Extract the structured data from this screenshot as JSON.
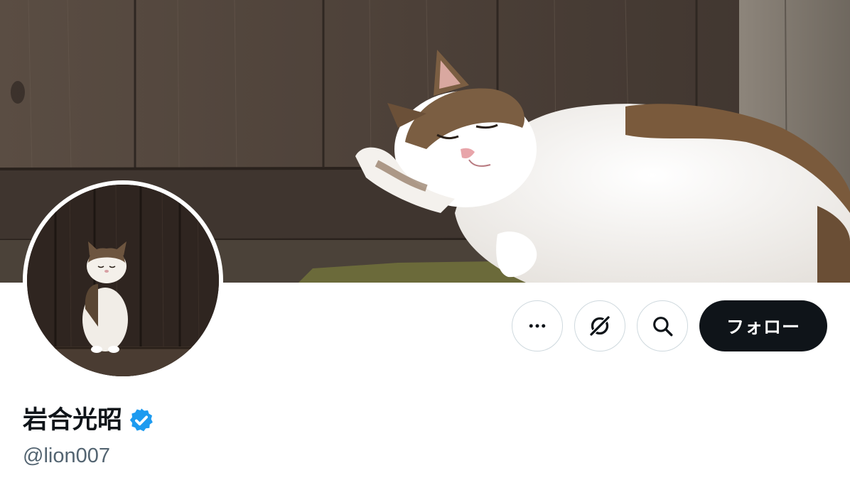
{
  "profile": {
    "display_name": "岩合光昭",
    "handle": "@lion007",
    "verified": true,
    "verified_color": "#1d9bf0"
  },
  "banner": {
    "image": "photo of a white-and-brown tabby cat stretching against a weathered wooden wall"
  },
  "avatar": {
    "image": "photo of a small cat sitting in front of dark wooden planks"
  },
  "actions": {
    "more_icon": "more-horizontal-icon",
    "grok_icon": "grok-slash-circle-icon",
    "search_icon": "search-icon",
    "follow_label": "フォロー",
    "follow_bg": "#0f1419"
  }
}
